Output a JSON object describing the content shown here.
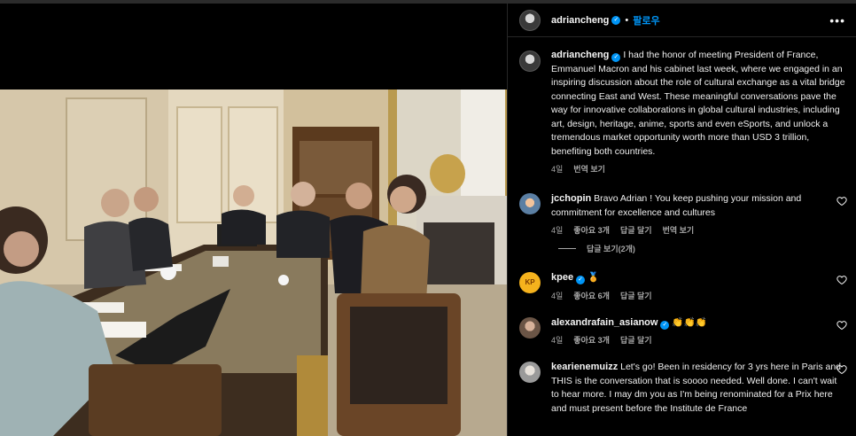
{
  "post": {
    "author": "adriancheng",
    "follow_label": "팔로우",
    "dot": "•",
    "more_label": "•••",
    "verified_mark": "✓",
    "caption": "I had the honor of meeting President of France, Emmanuel Macron and his cabinet last week, where we engaged in an inspiring discussion about the role of cultural exchange as a vital bridge connecting East and West. These meaningful conversations pave the way for innovative collaborations in global cultural industries, including art, design, heritage, anime, sports and even eSports, and unlock a tremendous market opportunity worth more than USD 3 trillion, benefiting both countries.",
    "caption_time": "4일",
    "caption_translate": "번역 보기"
  },
  "comments": [
    {
      "user": "jcchopin",
      "text": "Bravo Adrian ! You keep pushing your mission and commitment for excellence and cultures",
      "time": "4일",
      "likes": "좋아요 3개",
      "reply": "답글 달기",
      "translate": "번역 보기",
      "view_replies": "답글 보기(2개)"
    },
    {
      "user": "kpee",
      "avatar_text": "KP",
      "emoji": "🏅",
      "time": "4일",
      "likes": "좋아요 6개",
      "reply": "답글 달기"
    },
    {
      "user": "alexandrafain_asianow",
      "emoji": "👏👏👏",
      "time": "4일",
      "likes": "좋아요 3개",
      "reply": "답글 달기"
    },
    {
      "user": "kearienemuizz",
      "text": "Let's go! Been in residency for 3 yrs here in Paris and THIS is the conversation that is soooo needed. Well done. I can't wait to hear more. I may dm you as I'm being renominated for a Prix here and must present before the Institute de France"
    }
  ],
  "colors": {
    "accent": "#0095f6",
    "background": "#000000",
    "muted": "#a8a8a8"
  }
}
